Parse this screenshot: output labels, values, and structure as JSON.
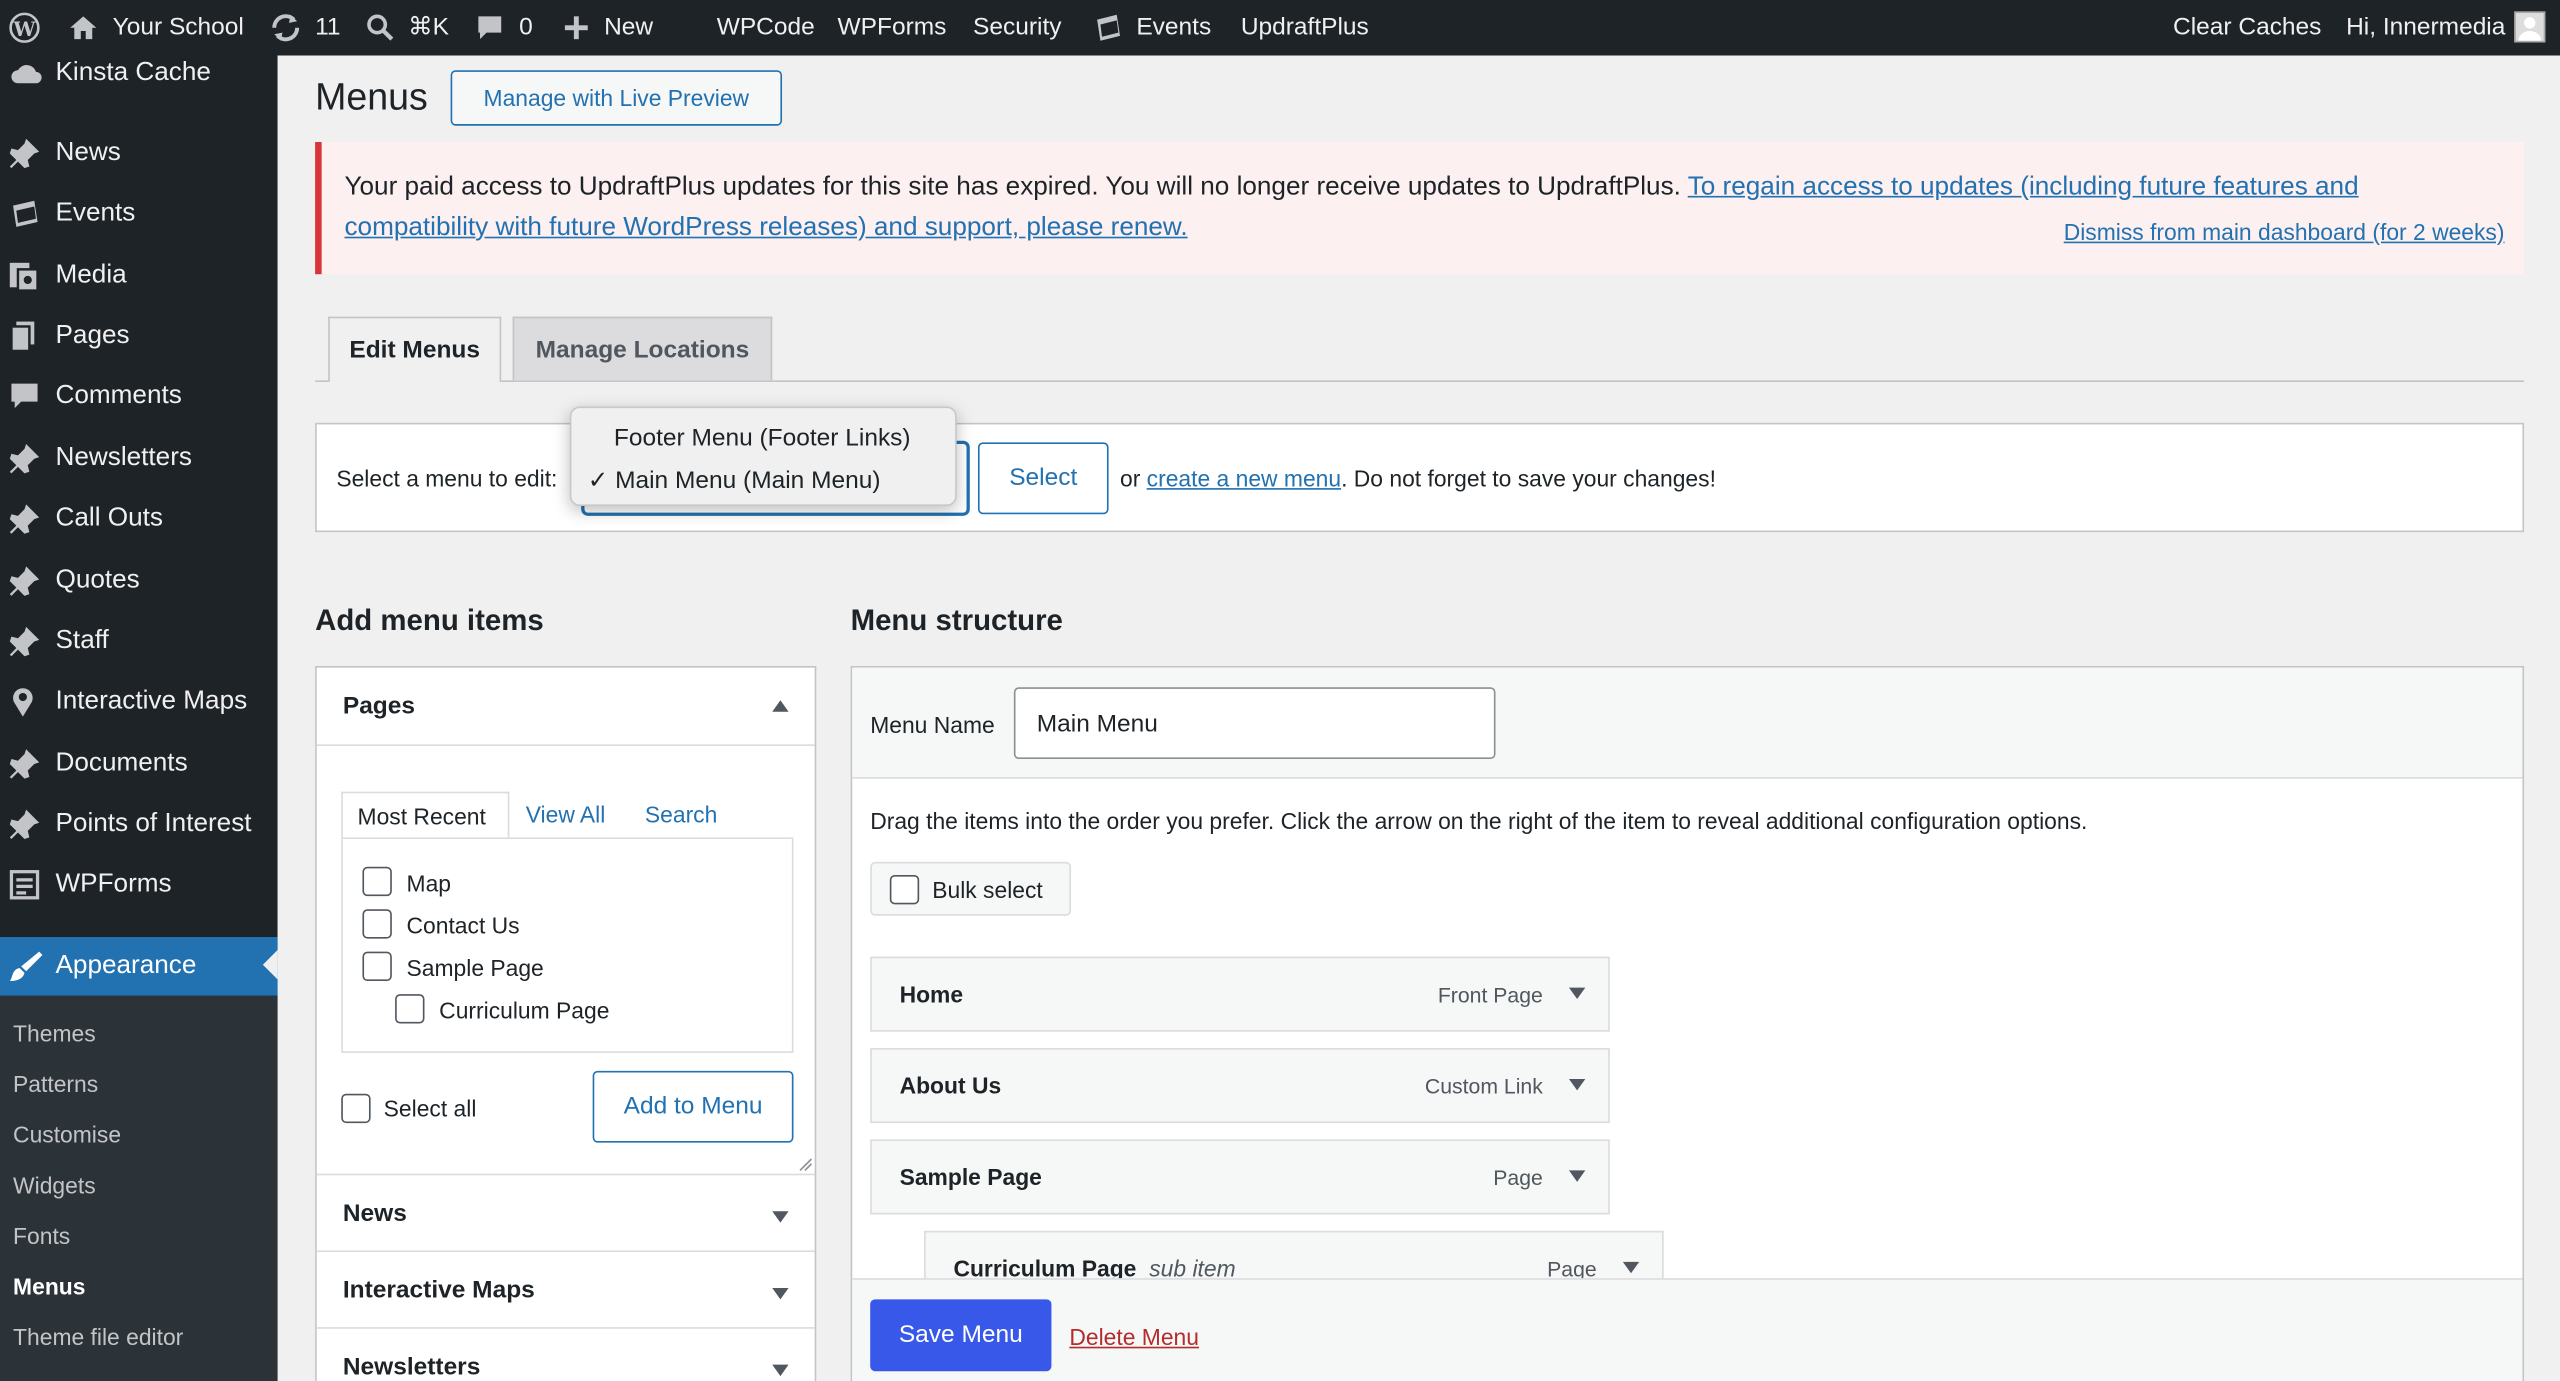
{
  "admin_bar": {
    "site_name": "Your School",
    "updates_count": "11",
    "search_shortcut": "⌘K",
    "comments_count": "0",
    "new_label": "New",
    "links": [
      "WPCode",
      "WPForms",
      "Security",
      "Events",
      "UpdraftPlus"
    ],
    "clear_caches": "Clear Caches",
    "greeting": "Hi, Innermedia"
  },
  "sidebar": {
    "top_partial": "Kinsta Cache",
    "items": [
      "News",
      "Events",
      "Media",
      "Pages",
      "Comments",
      "Newsletters",
      "Call Outs",
      "Quotes",
      "Staff",
      "Interactive Maps",
      "Documents",
      "Points of Interest",
      "WPForms"
    ],
    "active": "Appearance",
    "submenu": [
      "Themes",
      "Patterns",
      "Customise",
      "Widgets",
      "Fonts",
      "Menus",
      "Theme file editor"
    ],
    "current_submenu": "Menus"
  },
  "page": {
    "title": "Menus",
    "live_preview_button": "Manage with Live Preview"
  },
  "notice": {
    "text": "Your paid access to UpdraftPlus updates for this site has expired. You will no longer receive updates to UpdraftPlus.",
    "link_line1": "To regain access to updates (including future features and",
    "link_line2": "compatibility with future WordPress releases) and support, please renew.",
    "dismiss": "Dismiss from main dashboard (for 2 weeks)"
  },
  "tabs": [
    "Edit Menus",
    "Manage Locations"
  ],
  "select_bar": {
    "label": "Select a menu to edit:",
    "options": [
      "Footer Menu (Footer Links)",
      "Main Menu (Main Menu)"
    ],
    "selected": "Main Menu (Main Menu)",
    "selected_check": "✓",
    "select_button": "Select",
    "or_text": "or",
    "create_link": "create a new menu",
    "suffix": ". Do not forget to save your changes!"
  },
  "add_items": {
    "heading": "Add menu items",
    "pages_section": {
      "title": "Pages",
      "tabs": [
        "Most Recent",
        "View All",
        "Search"
      ],
      "pages": [
        "Map",
        "Contact Us",
        "Sample Page"
      ],
      "child_page": "Curriculum Page",
      "select_all": "Select all",
      "add_button": "Add to Menu"
    },
    "collapsed_sections": [
      "News",
      "Interactive Maps",
      "Newsletters"
    ]
  },
  "structure": {
    "heading": "Menu structure",
    "menu_name_label": "Menu Name",
    "menu_name_value": "Main Menu",
    "instructions": "Drag the items into the order you prefer. Click the arrow on the right of the item to reveal additional configuration options.",
    "bulk_select": "Bulk select",
    "items": [
      {
        "title": "Home",
        "type": "Front Page"
      },
      {
        "title": "About Us",
        "type": "Custom Link"
      },
      {
        "title": "Sample Page",
        "type": "Page"
      }
    ],
    "sub_item": {
      "title": "Curriculum Page",
      "note": "sub item",
      "type": "Page"
    },
    "save_button": "Save Menu",
    "delete_link": "Delete Menu"
  },
  "colors": {
    "admin_bar_bg": "#1d2327",
    "accent": "#2271b1",
    "primary_button": "#3858e9",
    "notice_border": "#d63638",
    "delete_link": "#b32d2e"
  }
}
